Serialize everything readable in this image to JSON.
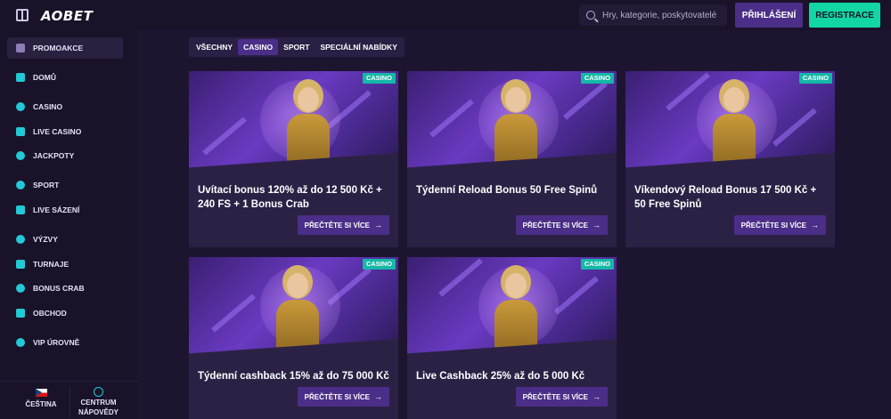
{
  "header": {
    "logo": "AOBET",
    "search_placeholder": "Hry, kategorie, poskytovatelé",
    "login_label": "PŘIHLÁŠENÍ",
    "register_label": "REGISTRACE"
  },
  "sidebar": {
    "items": [
      {
        "label": "PROMOAKCE",
        "icon": "gift-icon"
      },
      {
        "label": "DOMŮ",
        "icon": "home-icon"
      },
      {
        "label": "CASINO",
        "icon": "music-note-icon"
      },
      {
        "label": "LIVE CASINO",
        "icon": "live-cards-icon"
      },
      {
        "label": "JACKPOTY",
        "icon": "clover-icon"
      },
      {
        "label": "SPORT",
        "icon": "sport-icon"
      },
      {
        "label": "LIVE SÁZENÍ",
        "icon": "live-bet-icon"
      },
      {
        "label": "VÝZVY",
        "icon": "medal-icon"
      },
      {
        "label": "TURNAJE",
        "icon": "trophy-icon"
      },
      {
        "label": "BONUS CRAB",
        "icon": "crab-icon"
      },
      {
        "label": "OBCHOD",
        "icon": "basket-icon"
      },
      {
        "label": "VIP ÚROVNĚ",
        "icon": "diamond-icon"
      }
    ],
    "language": "ČEŠTINA",
    "help_line1": "CENTRUM",
    "help_line2": "NÁPOVĚDY"
  },
  "filters": {
    "tabs": [
      "VŠECHNY",
      "CASINO",
      "SPORT",
      "SPECIÁLNÍ NABÍDKY"
    ],
    "active": "CASINO"
  },
  "promos": [
    {
      "badge": "CASINO",
      "title": "Uvítací bonus 120% až do 12 500 Kč + 240 FS + 1 Bonus Crab",
      "cta": "PŘEČTĚTE SI VÍCE"
    },
    {
      "badge": "CASINO",
      "title": "Týdenní Reload Bonus 50 Free Spinů",
      "cta": "PŘEČTĚTE SI VÍCE"
    },
    {
      "badge": "CASINO",
      "title": "Víkendový Reload Bonus 17 500 Kč + 50 Free Spinů",
      "cta": "PŘEČTĚTE SI VÍCE"
    },
    {
      "badge": "CASINO",
      "title": "Týdenní cashback 15% až do 75 000 Kč",
      "cta": "PŘEČTĚTE SI VÍCE"
    },
    {
      "badge": "CASINO",
      "title": "Live Cashback 25% až do 5 000 Kč",
      "cta": "PŘEČTĚTE SI VÍCE"
    }
  ],
  "colors": {
    "background": "#1d1530",
    "accent_purple": "#4a2e87",
    "accent_green": "#12d6a3",
    "badge_teal": "#14b8a6"
  }
}
